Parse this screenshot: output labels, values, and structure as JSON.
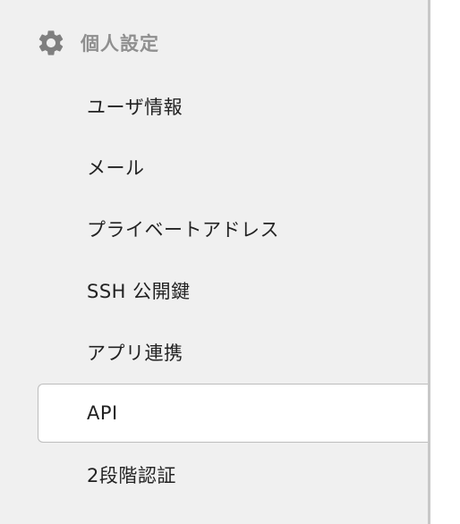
{
  "sidebar": {
    "section": {
      "icon": "gear-icon",
      "title": "個人設定"
    },
    "items": [
      {
        "label": "ユーザ情報"
      },
      {
        "label": "メール"
      },
      {
        "label": "プライベートアドレス"
      },
      {
        "label": "SSH 公開鍵"
      },
      {
        "label": "アプリ連携"
      },
      {
        "label": "API",
        "active": true
      },
      {
        "label": "2段階認証"
      }
    ]
  },
  "colors": {
    "background": "#f0f0f0",
    "active_background": "#ffffff",
    "header_text": "#8f8f8f",
    "item_text": "#222222",
    "border": "#c8c8c8"
  }
}
